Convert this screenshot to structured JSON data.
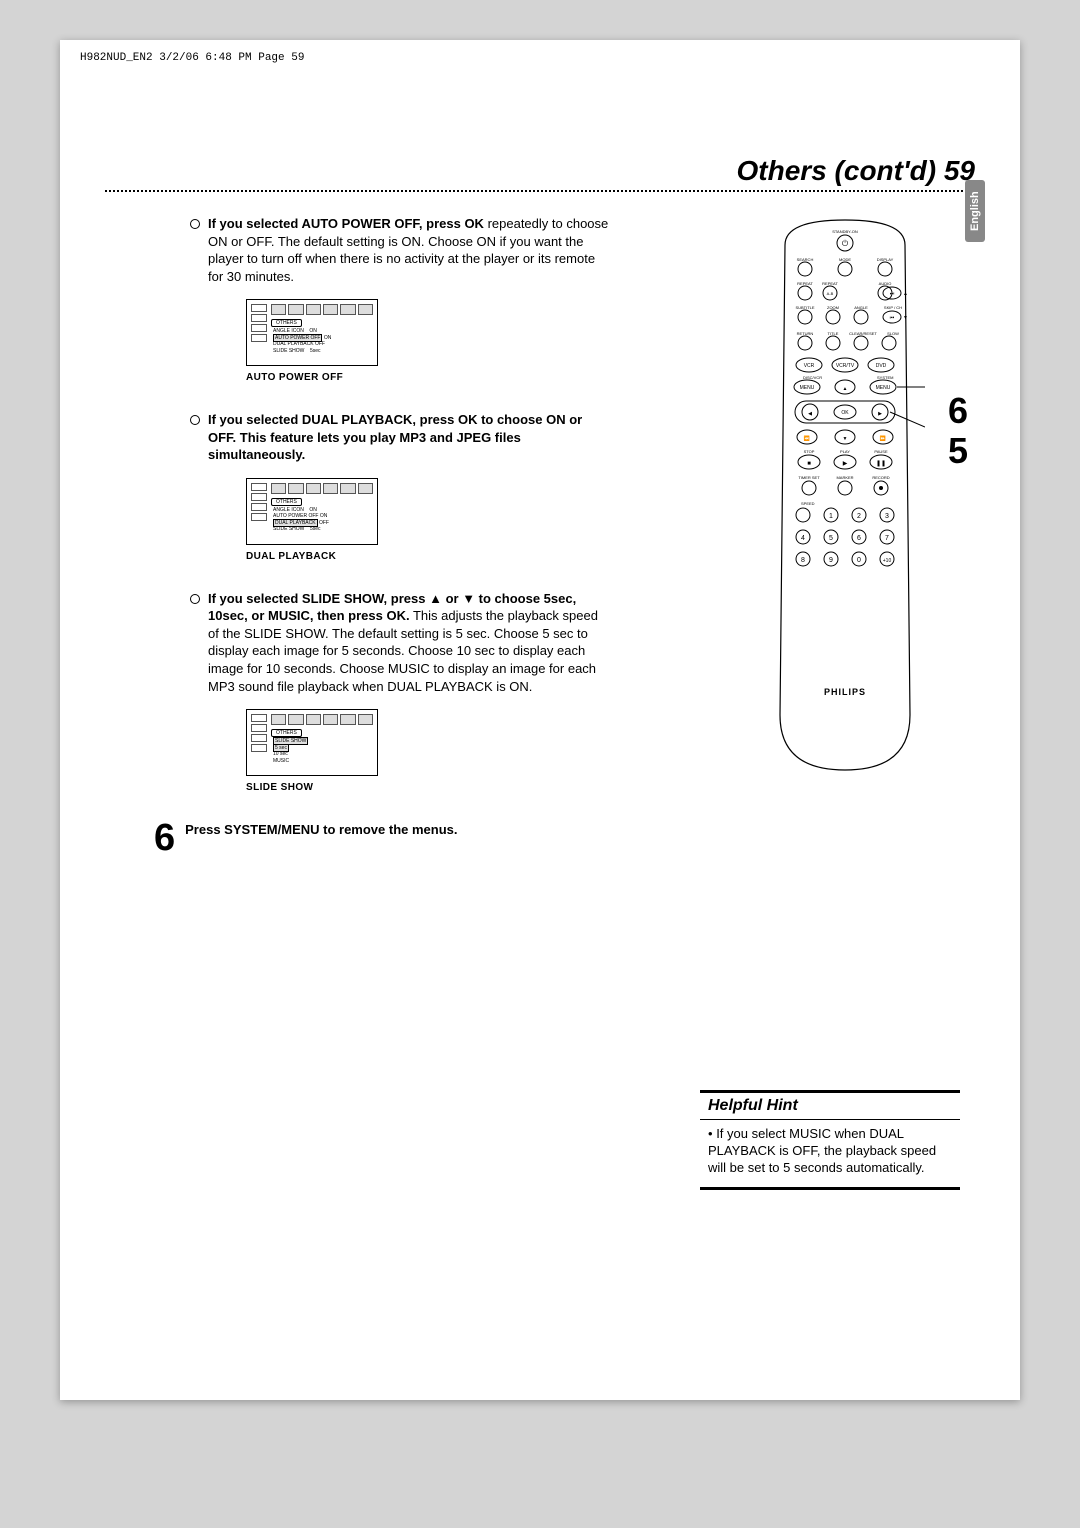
{
  "header": "H982NUD_EN2  3/2/06  6:48 PM  Page 59",
  "title": "Others (cont'd)  59",
  "lang_tab": "English",
  "sec1": {
    "bold": "If you selected AUTO POWER OFF, press OK",
    "rest": " repeatedly to choose ON or OFF. The default setting is ON. Choose ON if you want the player to turn off when there is no activity at the player or its remote for 30 minutes.",
    "caption": "AUTO POWER OFF",
    "fig": {
      "tab": "OTHERS",
      "l1a": "ANGLE ICON",
      "l1b": "ON",
      "l2a": "AUTO POWER OFF",
      "l2b": "ON",
      "l3a": "DUAL PLAYBACK",
      "l3b": "OFF",
      "l4a": "SLIDE SHOW",
      "l4b": "5sec"
    }
  },
  "sec2": {
    "bold": "If you selected DUAL PLAYBACK, press OK to choose ON or OFF.  This feature lets you play MP3 and JPEG files simultaneously.",
    "caption": "DUAL PLAYBACK",
    "fig": {
      "tab": "OTHERS",
      "l1a": "ANGLE ICON",
      "l1b": "ON",
      "l2a": "AUTO POWER OFF",
      "l2b": "ON",
      "l3a": "DUAL PLAYBACK",
      "l3b": "OFF",
      "l4a": "SLIDE SHOW",
      "l4b": "5sec"
    }
  },
  "sec3": {
    "bold1": "If you selected SLIDE SHOW, press ",
    "up": "▲",
    "mid": " or ",
    "down": "▼",
    "bold2": " to choose 5sec, 10sec, or MUSIC, then press OK.",
    "rest": " This adjusts the playback speed of the SLIDE SHOW.  The default setting is 5 sec. Choose 5 sec to display each image for 5 seconds. Choose 10 sec to display each image for 10 seconds. Choose MUSIC to display an image for each MP3 sound file playback when DUAL PLAYBACK is ON.",
    "caption": "SLIDE SHOW",
    "fig": {
      "tab": "OTHERS",
      "l1": "SLIDE SHOW",
      "l2": "5 sec",
      "l3": "10 sec",
      "l4": "MUSIC"
    }
  },
  "step6_num": "6",
  "step6": "Press SYSTEM/MENU to remove the menus.",
  "callout6": "6",
  "callout5": "5",
  "hint_title": "Helpful Hint",
  "hint_bullet": "•",
  "hint_body": "If you select MUSIC when DUAL PLAYBACK is OFF, the playback speed will be set to 5 seconds automatically.",
  "remote": {
    "brand": "PHILIPS",
    "labels": {
      "standby": "STANDBY-ON",
      "search": "SEARCH",
      "mode": "MODE",
      "display": "DISPLAY",
      "repeat": "REPEAT",
      "ab": "A-B",
      "audio": "AUDIO",
      "subtitle": "SUBTITLE",
      "zoom": "ZOOM",
      "angle": "ANGLE",
      "skip": "SKIP / CH",
      "return": "RETURN",
      "title": "TITLE",
      "clear": "CLEAR/RESET",
      "slow": "SLOW",
      "vcr": "VCR",
      "vcrtv": "VCR/TV",
      "dvd": "DVD",
      "discvcr": "DISC/VCR",
      "system": "SYSTEM",
      "menu_l": "MENU",
      "menu_r": "MENU",
      "ok": "OK",
      "stop": "STOP",
      "play": "PLAY",
      "pause": "PAUSE",
      "timer": "TIMER SET",
      "marker": "MARKER",
      "record": "RECORD",
      "speed": "SPEED",
      "n1": "1",
      "n2": "2",
      "n3": "3",
      "n4": "4",
      "n5": "5",
      "n6": "6",
      "n7": "7",
      "n8": "8",
      "n9": "9",
      "n0": "0",
      "n10": "+10"
    }
  }
}
